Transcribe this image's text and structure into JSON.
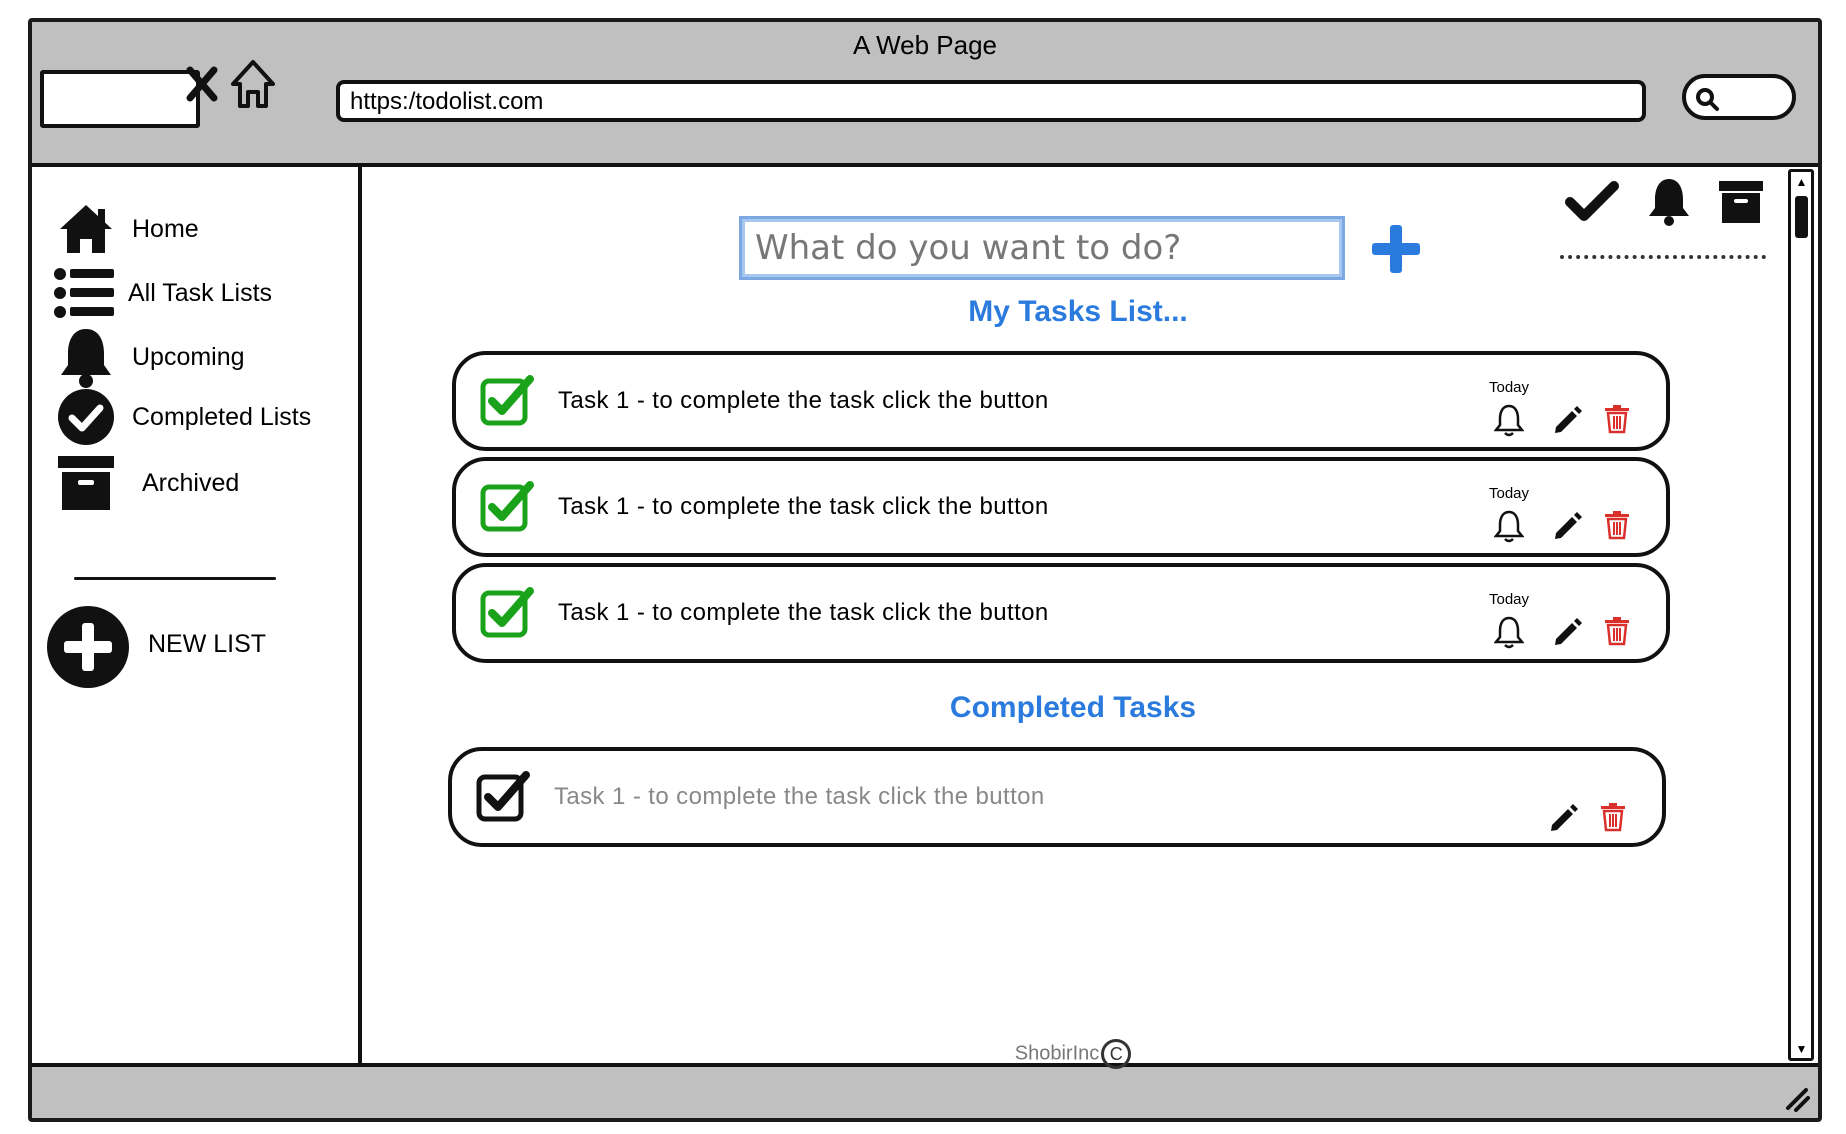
{
  "window": {
    "title": "A Web Page"
  },
  "browser": {
    "url": "https:/todolist.com"
  },
  "sidebar": {
    "items": [
      {
        "label": "Home",
        "icon": "home-icon"
      },
      {
        "label": "All Task Lists",
        "icon": "list-icon"
      },
      {
        "label": "Upcoming",
        "icon": "bell-icon"
      },
      {
        "label": "Completed Lists",
        "icon": "check-circle-icon"
      },
      {
        "label": "Archived",
        "icon": "archive-icon"
      }
    ],
    "new_list_label": "NEW LIST"
  },
  "main": {
    "input_placeholder": "What do you want to do?",
    "tasks_title": "My Tasks List...",
    "tasks": [
      {
        "text": "Task 1 - to complete the task click the button",
        "due": "Today"
      },
      {
        "text": "Task 1 - to complete the task click the button",
        "due": "Today"
      },
      {
        "text": "Task 1 - to complete the task click the button",
        "due": "Today"
      }
    ],
    "completed_title": "Completed Tasks",
    "completed": [
      {
        "text": "Task 1 - to complete the task click the button"
      }
    ],
    "footer": "ShobirInc",
    "footer_symbol": "C"
  },
  "colors": {
    "accent": "#2b7bde",
    "check_green": "#1aa31a",
    "trash_red": "#d9302c",
    "chrome": "#c0c0c0"
  }
}
